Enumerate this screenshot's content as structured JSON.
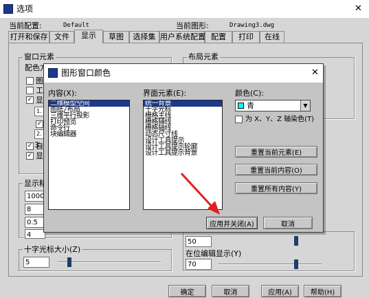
{
  "window": {
    "title": "选项",
    "close_glyph": "✕"
  },
  "header": {
    "current_profile_label": "当前配置:",
    "current_profile_value": "Default",
    "current_drawing_label": "当前图形:",
    "current_drawing_value": "Drawing3.dwg"
  },
  "tabs": [
    "打开和保存",
    "文件",
    "显示",
    "草图",
    "选择集",
    "用户系统配置",
    "配置",
    "打印",
    "在线"
  ],
  "active_tab": "显示",
  "background": {
    "window_elements_title": "窗口元素",
    "color_scheme_label": "配色方案",
    "layout_elements_title": "布局元素",
    "display_resolution_title": "显示精度",
    "resolution_values": [
      "1000",
      "8",
      "0.5",
      "4"
    ],
    "crosshair_label": "十字光标大小(Z)",
    "crosshair_value": "5",
    "crosshair_level": 0.1,
    "right_value_1": "50",
    "inplace_edit_label": "在位编辑显示(Y)",
    "right_value_2": "70",
    "left_checkbox_labels": [
      "图",
      "工",
      "显",
      "1.",
      "2.",
      "3.",
      "自",
      "显"
    ]
  },
  "footer": {
    "ok": "确定",
    "cancel": "取消",
    "apply": "应用(A)",
    "help": "帮助(H)"
  },
  "dialog": {
    "title": "图形窗口颜色",
    "close_glyph": "✕",
    "context_label": "内容(X):",
    "context_items": [
      "二维模型空间",
      "图纸/布局",
      "三维平行投影",
      "打印预览",
      "命令行",
      "块编辑器"
    ],
    "context_selected": 0,
    "element_label": "界面元素(E):",
    "element_items": [
      "统一背景",
      "十字光标",
      "栅格主线",
      "栅格辅线",
      "栅格轴线",
      "动态尺寸线",
      "设计工具提示",
      "设计工具提示轮廓",
      "设计工具提示背景"
    ],
    "element_selected": 0,
    "color_label": "颜色(C):",
    "color_value": "青",
    "color_swatch": "#00ffff",
    "tint_label": "为 X、Y、Z 轴染色(T)",
    "restore_element": "重置当前元素(E)",
    "restore_context": "重置当前内容(O)",
    "restore_all": "重置所有内容(Y)",
    "apply_close": "应用并关闭(A)",
    "cancel": "取消"
  },
  "colors": {
    "window_bg": "#d6d6d6",
    "dimmed_bg": "#9a9a9a",
    "dialog_bg": "#c0c0c0",
    "selection": "#1b3a8c",
    "annotation_arrow": "#e02020"
  }
}
